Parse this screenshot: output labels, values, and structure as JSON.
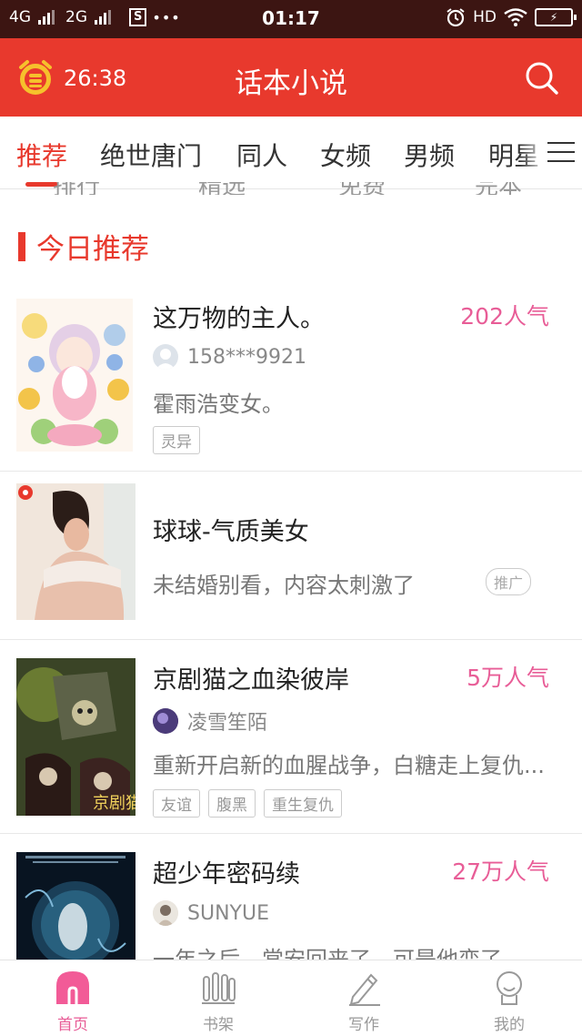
{
  "status_bar": {
    "network_1": "4G",
    "network_2": "2G",
    "sim_icon": "S",
    "dots": "•••",
    "time": "01:17",
    "hd": "HD"
  },
  "header": {
    "timer": "26:38",
    "title": "话本小说",
    "accent_color": "#e8392d"
  },
  "tabs": [
    {
      "label": "推荐",
      "active": true
    },
    {
      "label": "绝世唐门"
    },
    {
      "label": "同人"
    },
    {
      "label": "女频"
    },
    {
      "label": "男频"
    },
    {
      "label": "明星"
    }
  ],
  "categories": [
    "排行",
    "精选",
    "免费",
    "完本"
  ],
  "section_title": "今日推荐",
  "books": [
    {
      "title": "这万物的主人。",
      "popularity": "202人气",
      "author": "158***9921",
      "description": "霍雨浩变女。",
      "tags": [
        "灵异"
      ]
    },
    {
      "title": "球球-气质美女",
      "description": "未结婚别看，内容太刺激了",
      "badge": "推广",
      "is_ad": true
    },
    {
      "title": "京剧猫之血染彼岸",
      "popularity": "5万人气",
      "author": "凌雪笙陌",
      "description": "重新开启新的血腥战争，白糖走上复仇...",
      "tags": [
        "友谊",
        "腹黑",
        "重生复仇"
      ]
    },
    {
      "title": "超少年密码续",
      "popularity": "27万人气",
      "author": "SUNYUE",
      "description": "一年之后，常安回来了，可是他变了"
    }
  ],
  "bottom_nav": [
    {
      "label": "首页",
      "icon": "home-icon",
      "active": true
    },
    {
      "label": "书架",
      "icon": "bookshelf-icon"
    },
    {
      "label": "写作",
      "icon": "pen-icon"
    },
    {
      "label": "我的",
      "icon": "profile-icon"
    }
  ],
  "colors": {
    "status_bar": "#3c1512",
    "popularity": "#e85d97",
    "nav_active": "#e85d97"
  }
}
